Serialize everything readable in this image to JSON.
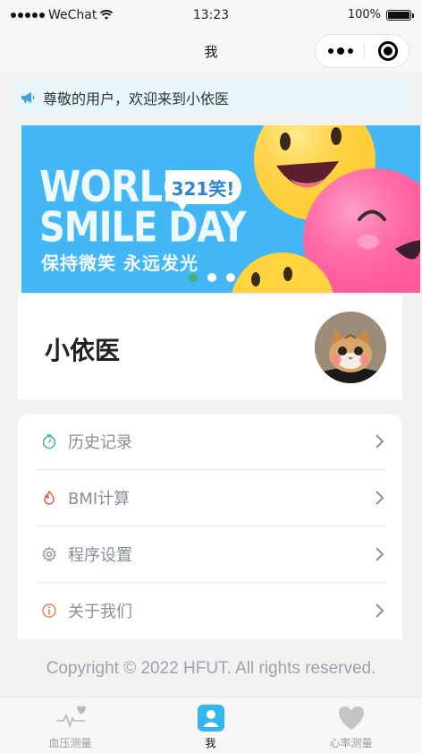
{
  "status_bar": {
    "carrier": "WeChat",
    "time": "13:23",
    "battery": "100%",
    "battery_level": 1.0
  },
  "nav": {
    "title": "我"
  },
  "notice": {
    "text": "尊敬的用户，欢迎来到小依医"
  },
  "banner": {
    "line1": "WORLD",
    "line2": "SMILE DAY",
    "bubble": "321笑!",
    "slogan": "保持微笑  永远发光",
    "slides": 3,
    "active_slide": 0
  },
  "profile": {
    "name": "小依医"
  },
  "menu": {
    "items": [
      {
        "label": "历史记录",
        "icon": "stopwatch-icon"
      },
      {
        "label": "BMI计算",
        "icon": "flame-icon"
      },
      {
        "label": "程序设置",
        "icon": "gear-icon"
      },
      {
        "label": "关于我们",
        "icon": "info-icon"
      }
    ]
  },
  "footer": {
    "copyright": "Copyright © 2022 HFUT. All rights reserved."
  },
  "tabbar": {
    "items": [
      {
        "label": "血压测量",
        "icon": "heartbeat-icon",
        "active": false
      },
      {
        "label": "我",
        "icon": "user-icon",
        "active": true
      },
      {
        "label": "心率测量",
        "icon": "heart-icon",
        "active": false
      }
    ]
  },
  "colors": {
    "accent": "#34b7f1",
    "notice_bg": "#e6f6fb",
    "banner_bg": "#43b6f5",
    "muted_text": "#888f96"
  }
}
